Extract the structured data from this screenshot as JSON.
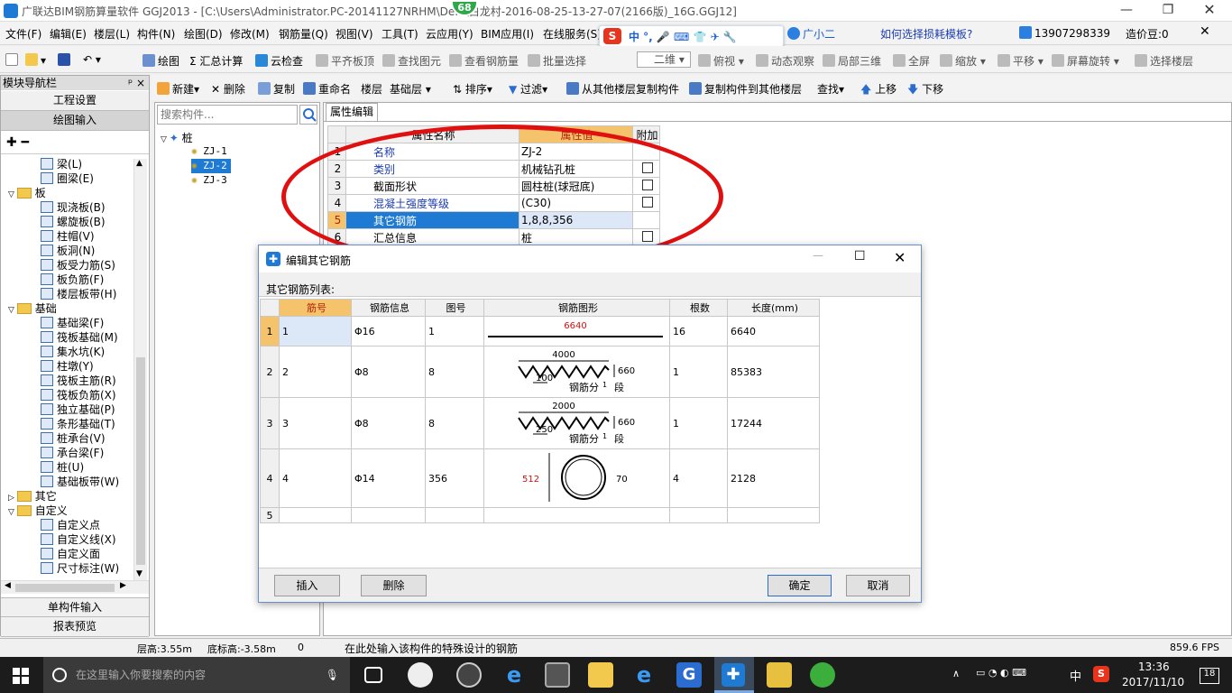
{
  "title": "广联达BIM钢筋算量软件 GGJ2013 - [C:\\Users\\Administrator.PC-20141127NRHM\\De...\\白龙村-2016-08-25-13-27-07(2166版)_16G.GGJ12]",
  "badge": "68",
  "menus": [
    "文件(F)",
    "编辑(E)",
    "楼层(L)",
    "构件(N)",
    "绘图(D)",
    "修改(M)",
    "钢筋量(Q)",
    "视图(V)",
    "工具(T)",
    "云应用(Y)",
    "BIM应用(I)",
    "在线服务(S)"
  ],
  "menu_right": {
    "helper": "广小二",
    "question": "如何选择损耗模板?",
    "phone": "13907298339",
    "bean": "造价豆:0"
  },
  "sogou": {
    "s": "S",
    "text": "中 °, 🎤 ⌨ 👕 ✈ 🔧"
  },
  "toolbar1": [
    "绘图",
    "汇总计算",
    "云检查",
    "平齐板顶",
    "查找图元",
    "查看钢筋量",
    "批量选择",
    "二维",
    "俯视",
    "动态观察",
    "局部三维",
    "全屏",
    "缩放",
    "平移",
    "屏幕旋转",
    "选择楼层"
  ],
  "toolbar2": [
    "新建",
    "删除",
    "复制",
    "重命名",
    "楼层",
    "基础层",
    "排序",
    "过滤",
    "从其他楼层复制构件",
    "复制构件到其他楼层",
    "查找",
    "上移",
    "下移"
  ],
  "nav": {
    "header": "模块导航栏",
    "pin": "ᵖ ×",
    "btn_project": "工程设置",
    "btn_draw": "绘图输入",
    "btn_single": "单构件输入",
    "btn_report": "报表预览",
    "items": [
      {
        "label": "梁(L)",
        "indent": 2,
        "type": "icon"
      },
      {
        "label": "圈梁(E)",
        "indent": 2,
        "type": "icon"
      },
      {
        "label": "板",
        "indent": 0,
        "type": "folder"
      },
      {
        "label": "现浇板(B)",
        "indent": 2,
        "type": "icon"
      },
      {
        "label": "螺旋板(B)",
        "indent": 2,
        "type": "icon"
      },
      {
        "label": "柱帽(V)",
        "indent": 2,
        "type": "icon"
      },
      {
        "label": "板洞(N)",
        "indent": 2,
        "type": "icon"
      },
      {
        "label": "板受力筋(S)",
        "indent": 2,
        "type": "icon"
      },
      {
        "label": "板负筋(F)",
        "indent": 2,
        "type": "icon"
      },
      {
        "label": "楼层板带(H)",
        "indent": 2,
        "type": "icon"
      },
      {
        "label": "基础",
        "indent": 0,
        "type": "folder"
      },
      {
        "label": "基础梁(F)",
        "indent": 2,
        "type": "icon"
      },
      {
        "label": "筏板基础(M)",
        "indent": 2,
        "type": "icon"
      },
      {
        "label": "集水坑(K)",
        "indent": 2,
        "type": "icon"
      },
      {
        "label": "柱墩(Y)",
        "indent": 2,
        "type": "icon"
      },
      {
        "label": "筏板主筋(R)",
        "indent": 2,
        "type": "icon"
      },
      {
        "label": "筏板负筋(X)",
        "indent": 2,
        "type": "icon"
      },
      {
        "label": "独立基础(P)",
        "indent": 2,
        "type": "icon"
      },
      {
        "label": "条形基础(T)",
        "indent": 2,
        "type": "icon"
      },
      {
        "label": "桩承台(V)",
        "indent": 2,
        "type": "icon"
      },
      {
        "label": "承台梁(F)",
        "indent": 2,
        "type": "icon"
      },
      {
        "label": "桩(U)",
        "indent": 2,
        "type": "icon"
      },
      {
        "label": "基础板带(W)",
        "indent": 2,
        "type": "icon"
      },
      {
        "label": "其它",
        "indent": 0,
        "type": "folder"
      },
      {
        "label": "自定义",
        "indent": 0,
        "type": "folder"
      },
      {
        "label": "自定义点",
        "indent": 2,
        "type": "icon"
      },
      {
        "label": "自定义线(X)",
        "indent": 2,
        "type": "icon"
      },
      {
        "label": "自定义面",
        "indent": 2,
        "type": "icon"
      },
      {
        "label": "尺寸标注(W)",
        "indent": 2,
        "type": "icon"
      }
    ]
  },
  "complist": {
    "placeholder": "搜索构件...",
    "root": "桩",
    "items": [
      "ZJ-1",
      "ZJ-2",
      "ZJ-3"
    ],
    "selected": 1
  },
  "props": {
    "tab": "属性编辑",
    "headers": [
      "属性名称",
      "属性值",
      "附加"
    ],
    "rows": [
      {
        "n": "1",
        "name": "名称",
        "value": "ZJ-2",
        "blue": true,
        "cb": false
      },
      {
        "n": "2",
        "name": "类别",
        "value": "机械钻孔桩",
        "blue": true,
        "cb": true
      },
      {
        "n": "3",
        "name": "截面形状",
        "value": "圆柱桩(球冠底)",
        "blue": false,
        "cb": true
      },
      {
        "n": "4",
        "name": "混凝土强度等级",
        "value": "(C30)",
        "blue": true,
        "cb": true
      },
      {
        "n": "5",
        "name": "其它钢筋",
        "value": "1,8,8,356",
        "blue": false,
        "cb": false,
        "sel": true
      },
      {
        "n": "6",
        "name": "汇总信息",
        "value": "桩",
        "blue": false,
        "cb": true
      }
    ]
  },
  "dialog": {
    "title": "编辑其它钢筋",
    "list_label": "其它钢筋列表:",
    "headers": [
      "筋号",
      "钢筋信息",
      "图号",
      "钢筋图形",
      "根数",
      "长度(mm)"
    ],
    "rows": [
      {
        "n": "1",
        "no": "1",
        "info": "Φ16",
        "fig": "1",
        "count": "16",
        "len": "6640",
        "shape": "straight",
        "dim": "6640"
      },
      {
        "n": "2",
        "no": "2",
        "info": "Φ8",
        "fig": "8",
        "count": "1",
        "len": "85383",
        "shape": "zigzag",
        "dim": "4000",
        "pitch": "100",
        "h": "660",
        "note": "钢筋分",
        "sub": "1",
        "seg": "段"
      },
      {
        "n": "3",
        "no": "3",
        "info": "Φ8",
        "fig": "8",
        "count": "1",
        "len": "17244",
        "shape": "zigzag",
        "dim": "2000",
        "pitch": "250",
        "h": "660",
        "note": "钢筋分",
        "sub": "1",
        "seg": "段"
      },
      {
        "n": "4",
        "no": "4",
        "info": "Φ14",
        "fig": "356",
        "count": "4",
        "len": "2128",
        "shape": "ring",
        "dim": "512",
        "side": "70"
      },
      {
        "n": "5",
        "no": "",
        "info": "",
        "fig": "",
        "count": "",
        "len": ""
      }
    ],
    "btn_insert": "插入",
    "btn_delete": "删除",
    "btn_ok": "确定",
    "btn_cancel": "取消"
  },
  "status": {
    "floor_h": "层高:3.55m",
    "base_h": "底标高:-3.58m",
    "zero": "0",
    "hint": "在此处输入该构件的特殊设计的钢筋",
    "fps": "859.6 FPS"
  },
  "taskbar": {
    "search": "在这里输入你要搜索的内容",
    "time": "13:36",
    "date": "2017/11/10",
    "lang": "中",
    "notif": "18"
  },
  "colors": {
    "accent": "#1e7ad2",
    "red": "#e01010",
    "header_value": "#f5c36b",
    "select": "#1e7ad2"
  }
}
